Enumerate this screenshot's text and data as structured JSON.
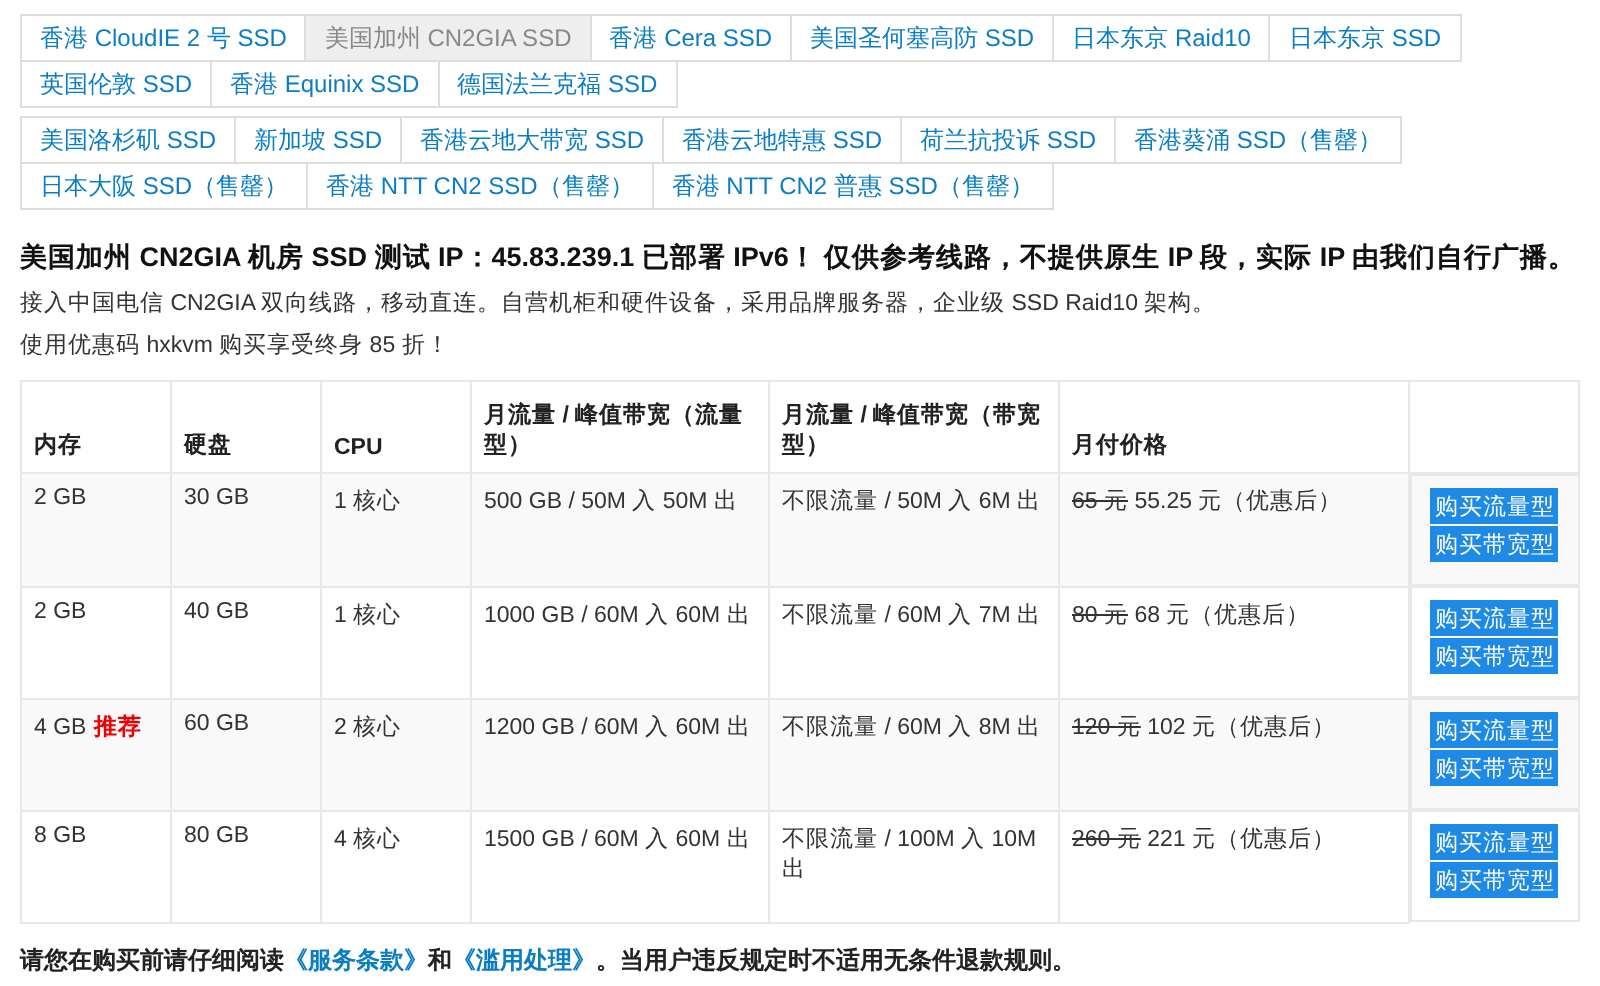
{
  "tab_groups": [
    {
      "tabs": [
        {
          "label": "香港 CloudIE 2 号 SSD",
          "selected": false
        },
        {
          "label": "美国加州 CN2GIA SSD",
          "selected": true
        },
        {
          "label": "香港 Cera SSD",
          "selected": false
        },
        {
          "label": "美国圣何塞高防 SSD",
          "selected": false
        },
        {
          "label": "日本东京 Raid10",
          "selected": false
        },
        {
          "label": "日本东京 SSD",
          "selected": false
        },
        {
          "label": "英国伦敦 SSD",
          "selected": false
        },
        {
          "label": "香港 Equinix SSD",
          "selected": false
        },
        {
          "label": "德国法兰克福 SSD",
          "selected": false
        }
      ]
    },
    {
      "tabs": [
        {
          "label": "美国洛杉矶 SSD",
          "selected": false
        },
        {
          "label": "新加坡 SSD",
          "selected": false
        },
        {
          "label": "香港云地大带宽 SSD",
          "selected": false
        },
        {
          "label": "香港云地特惠 SSD",
          "selected": false
        },
        {
          "label": "荷兰抗投诉 SSD",
          "selected": false
        },
        {
          "label": "香港葵涌 SSD（售罄）",
          "selected": false
        },
        {
          "label": "日本大阪 SSD（售罄）",
          "selected": false
        },
        {
          "label": "香港 NTT CN2 SSD（售罄）",
          "selected": false
        },
        {
          "label": "香港 NTT CN2 普惠 SSD（售罄）",
          "selected": false
        }
      ]
    }
  ],
  "heading": "美国加州 CN2GIA 机房 SSD 测试 IP：45.83.239.1 已部署 IPv6！ 仅供参考线路，不提供原生 IP 段，实际 IP 由我们自行广播。",
  "description": "接入中国电信 CN2GIA 双向线路，移动直连。自营机柜和硬件设备，采用品牌服务器，企业级 SSD Raid10 架构。",
  "promo": "使用优惠码 hxkvm 购买享受终身 85 折！",
  "table": {
    "columns": [
      "内存",
      "硬盘",
      "CPU",
      "月流量 / 峰值带宽（流量型）",
      "月流量 / 峰值带宽（带宽型）",
      "月付价格"
    ],
    "rows": [
      {
        "memory": "2 GB",
        "tag": "",
        "disk": "30 GB",
        "cpu": "1 核心",
        "traffic_plan": "500 GB / 50M 入 50M 出",
        "bandwidth_plan": "不限流量 / 50M 入 6M 出",
        "old_price": "65 元",
        "price": "55.25 元（优惠后）",
        "buttons": [
          "购买流量型",
          "购买带宽型"
        ]
      },
      {
        "memory": "2 GB",
        "tag": "",
        "disk": "40 GB",
        "cpu": "1 核心",
        "traffic_plan": "1000 GB / 60M 入 60M 出",
        "bandwidth_plan": "不限流量 / 60M 入 7M 出",
        "old_price": "80 元",
        "price": "68 元（优惠后）",
        "buttons": [
          "购买流量型",
          "购买带宽型"
        ]
      },
      {
        "memory": "4 GB",
        "tag": "推荐",
        "disk": "60 GB",
        "cpu": "2 核心",
        "traffic_plan": "1200 GB / 60M 入 60M 出",
        "bandwidth_plan": "不限流量 / 60M 入 8M 出",
        "old_price": "120 元",
        "price": "102 元（优惠后）",
        "buttons": [
          "购买流量型",
          "购买带宽型"
        ]
      },
      {
        "memory": "8 GB",
        "tag": "",
        "disk": "80 GB",
        "cpu": "4 核心",
        "traffic_plan": "1500 GB / 60M 入 60M 出",
        "bandwidth_plan": "不限流量 / 100M 入 10M 出",
        "old_price": "260 元",
        "price": "221 元（优惠后）",
        "buttons": [
          "购买流量型",
          "购买带宽型"
        ]
      }
    ]
  },
  "notice": {
    "before": "请您在购买前请仔细阅读",
    "link_1": "《服务条款》",
    "between": "和",
    "link_2": "《滥用处理》",
    "after": "。当用户违反规定时不适用无条件退款规则。"
  }
}
